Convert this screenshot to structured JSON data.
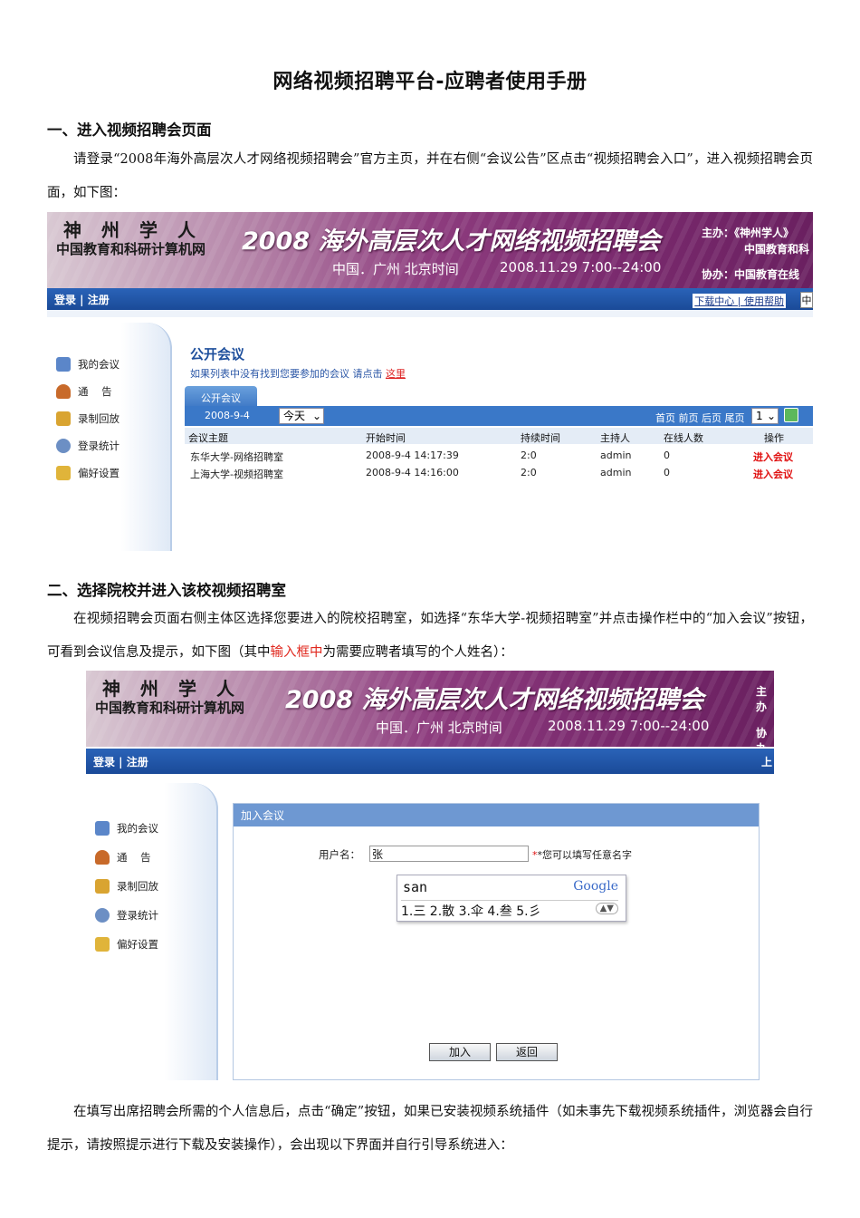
{
  "doc": {
    "title": "网络视频招聘平台-应聘者使用手册",
    "sec1_heading": "一、进入视频招聘会页面",
    "sec1_para": "请登录“2008年海外高层次人才网络视频招聘会”官方主页，并在右侧“会议公告”区点击“视频招聘会入口”，进入视频招聘会页面，如下图：",
    "sec2_heading": "二、选择院校并进入该校视频招聘室",
    "sec2_para_a": "在视频招聘会页面右侧主体区选择您要进入的院校招聘室，如选择“东华大学-视频招聘室”并点击操作栏中的“加入会议”按钮，可看到会议信息及提示，如下图（其中",
    "sec2_para_red": "输入框中",
    "sec2_para_b": "为需要应聘者填写的个人姓名）：",
    "sec3_para": "在填写出席招聘会所需的个人信息后，点击“确定”按钮，如果已安装视频系统插件（如未事先下载视频系统插件，浏览器会自行提示，请按照提示进行下载及安装操作），会出现以下界面并自行引导系统进入："
  },
  "banner": {
    "logo_line1": "神州学人",
    "logo_line2": "中国教育和科研计算机网",
    "title": "2008 海外高层次人才网络视频招聘会",
    "location": "中国．广州  北京时间",
    "datetime": "2008.11.29  7:00--24:00",
    "host_line1": "主办：《神州学人》",
    "host_line2": "中国教育和科",
    "coorg": "协办：中国教育在线",
    "host_short": "主办",
    "coorg_short": "协办"
  },
  "nav": {
    "login_reg": "登录 | 注册",
    "links": "下载中心 | 使用帮助",
    "right_char": "中"
  },
  "sidebar": {
    "items": [
      {
        "label": "我的会议",
        "icon": "monitor-icon",
        "color": "#5b86c9"
      },
      {
        "label": "通    告",
        "icon": "person-icon",
        "color": "#c86a2a"
      },
      {
        "label": "录制回放",
        "icon": "picture-icon",
        "color": "#d9a431"
      },
      {
        "label": "登录统计",
        "icon": "gears-icon",
        "color": "#6c8fc4"
      },
      {
        "label": "偏好设置",
        "icon": "folder-icon",
        "color": "#e0b43a"
      }
    ]
  },
  "screen1": {
    "heading": "公开会议",
    "hint": "如果列表中没有找到您要参加的会议  请点击",
    "hint_link": "这里",
    "tab": "公开会议",
    "date": "2008-9-4",
    "day_select": "今天",
    "pager": "首页 前页 后页 尾页",
    "page_select": "1",
    "columns": [
      "会议主题",
      "开始时间",
      "持续时间",
      "主持人",
      "在线人数",
      "操作"
    ],
    "rows": [
      [
        "东华大学-网络招聘室",
        "2008-9-4 14:17:39",
        "2:0",
        "admin",
        "0",
        "进入会议"
      ],
      [
        "上海大学-视频招聘室",
        "2008-9-4 14:16:00",
        "2:0",
        "admin",
        "0",
        "进入会议"
      ]
    ]
  },
  "screen2": {
    "panel_title": "加入会议",
    "username_label": "用户名：",
    "username_value": "张",
    "username_note": "*您可以填写任意名字",
    "ime_input": "san",
    "ime_brand": "Google",
    "ime_candidates": "1.三 2.散 3.伞 4.叁 5.彡",
    "ime_arrows": "▲▼",
    "join_button": "加入",
    "back_button": "返回",
    "right_edge": "上"
  }
}
